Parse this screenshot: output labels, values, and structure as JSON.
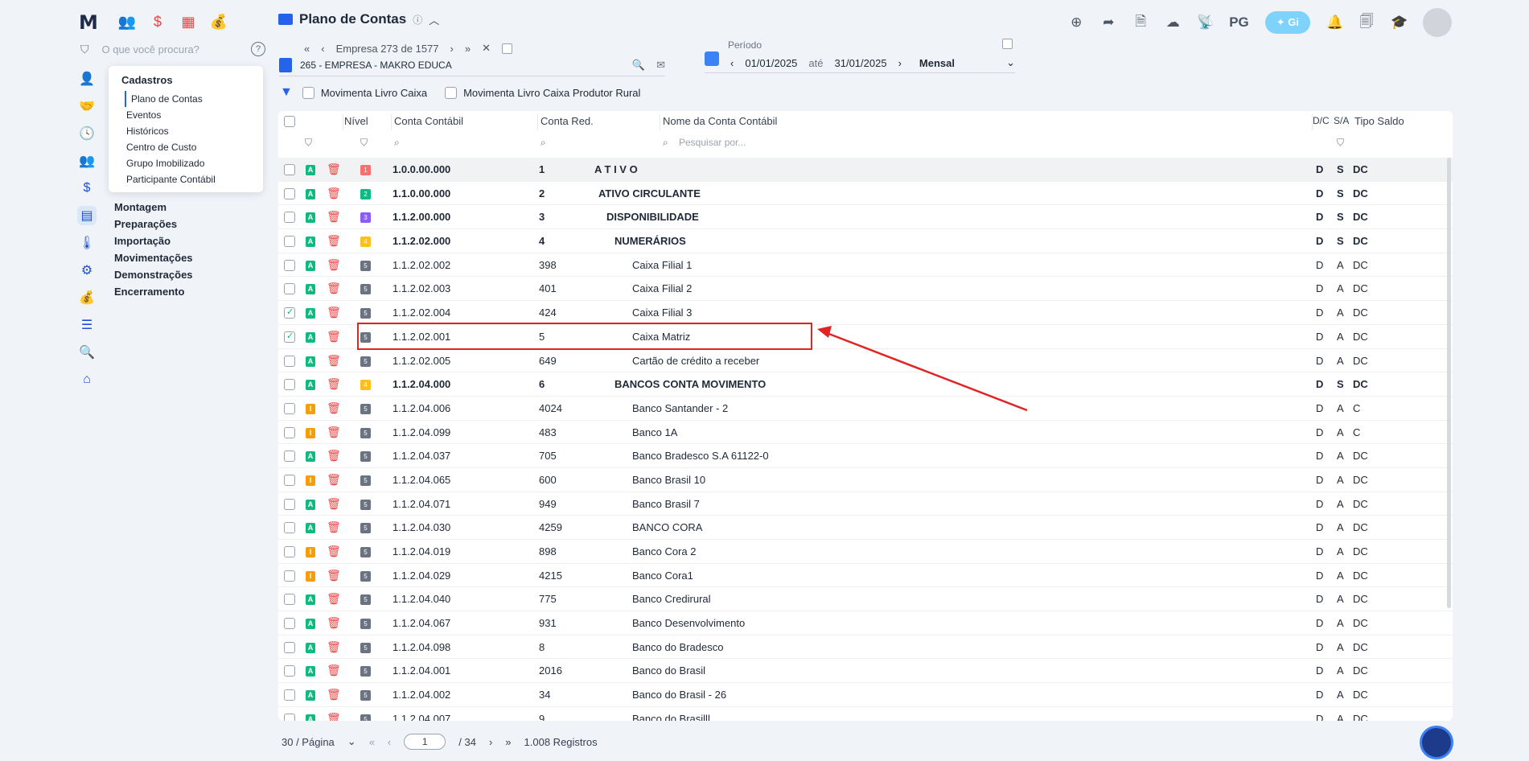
{
  "app": {
    "title": "Plano de Contas",
    "logo": "M"
  },
  "sidebar": {
    "search_placeholder": "O que você procura?",
    "popup": {
      "header": "Cadastros",
      "items": [
        "Plano de Contas",
        "Eventos",
        "Históricos",
        "Centro de Custo",
        "Grupo Imobilizado",
        "Participante Contábil"
      ]
    },
    "menu": [
      "Montagem",
      "Preparações",
      "Importação",
      "Movimentações",
      "Demonstrações",
      "Encerramento"
    ]
  },
  "header": {
    "pg_label": "PG",
    "gi_label": "Gi"
  },
  "empresa": {
    "nav_label": "Empresa 273 de 1577",
    "name": "265 - EMPRESA - MAKRO EDUCA"
  },
  "periodo": {
    "label": "Período",
    "start": "01/01/2025",
    "ate": "até",
    "end": "31/01/2025",
    "mode": "Mensal"
  },
  "filters": {
    "f1": "Movimenta Livro Caixa",
    "f2": "Movimenta Livro Caixa Produtor Rural"
  },
  "table": {
    "headers": {
      "nivel": "Nível",
      "conta": "Conta Contábil",
      "red": "Conta Red.",
      "nome": "Nome da Conta Contábil",
      "dc": "D/C",
      "sa": "S/A",
      "tipo": "Tipo Saldo"
    },
    "name_search_placeholder": "Pesquisar por...",
    "rows": [
      {
        "status": "A",
        "level": "1",
        "conta": "1.0.0.00.000",
        "red": "1",
        "nome": "A T I V O",
        "dc": "D",
        "sa": "S",
        "tipo": "DC",
        "bold": true,
        "checked": false
      },
      {
        "status": "A",
        "level": "2",
        "conta": "1.1.0.00.000",
        "red": "2",
        "nome": "ATIVO CIRCULANTE",
        "dc": "D",
        "sa": "S",
        "tipo": "DC",
        "bold": true,
        "checked": false
      },
      {
        "status": "A",
        "level": "3",
        "conta": "1.1.2.00.000",
        "red": "3",
        "nome": "DISPONIBILIDADE",
        "dc": "D",
        "sa": "S",
        "tipo": "DC",
        "bold": true,
        "checked": false
      },
      {
        "status": "A",
        "level": "4",
        "conta": "1.1.2.02.000",
        "red": "4",
        "nome": "NUMERÁRIOS",
        "dc": "D",
        "sa": "S",
        "tipo": "DC",
        "bold": true,
        "checked": false
      },
      {
        "status": "A",
        "level": "5",
        "conta": "1.1.2.02.002",
        "red": "398",
        "nome": "Caixa Filial 1",
        "dc": "D",
        "sa": "A",
        "tipo": "DC",
        "bold": false,
        "checked": false
      },
      {
        "status": "A",
        "level": "5",
        "conta": "1.1.2.02.003",
        "red": "401",
        "nome": "Caixa Filial 2",
        "dc": "D",
        "sa": "A",
        "tipo": "DC",
        "bold": false,
        "checked": false
      },
      {
        "status": "A",
        "level": "5",
        "conta": "1.1.2.02.004",
        "red": "424",
        "nome": "Caixa Filial 3",
        "dc": "D",
        "sa": "A",
        "tipo": "DC",
        "bold": false,
        "checked": true
      },
      {
        "status": "A",
        "level": "5",
        "conta": "1.1.2.02.001",
        "red": "5",
        "nome": "Caixa Matriz",
        "dc": "D",
        "sa": "A",
        "tipo": "DC",
        "bold": false,
        "checked": true
      },
      {
        "status": "A",
        "level": "5",
        "conta": "1.1.2.02.005",
        "red": "649",
        "nome": "Cartão de crédito a receber",
        "dc": "D",
        "sa": "A",
        "tipo": "DC",
        "bold": false,
        "checked": false
      },
      {
        "status": "A",
        "level": "4",
        "conta": "1.1.2.04.000",
        "red": "6",
        "nome": "BANCOS CONTA MOVIMENTO",
        "dc": "D",
        "sa": "S",
        "tipo": "DC",
        "bold": true,
        "checked": false
      },
      {
        "status": "I",
        "level": "5",
        "conta": "1.1.2.04.006",
        "red": "4024",
        "nome": "Banco Santander - 2",
        "dc": "D",
        "sa": "A",
        "tipo": "C",
        "bold": false,
        "checked": false
      },
      {
        "status": "I",
        "level": "5",
        "conta": "1.1.2.04.099",
        "red": "483",
        "nome": "Banco 1A",
        "dc": "D",
        "sa": "A",
        "tipo": "C",
        "bold": false,
        "checked": false
      },
      {
        "status": "A",
        "level": "5",
        "conta": "1.1.2.04.037",
        "red": "705",
        "nome": "Banco Bradesco S.A 61122-0",
        "dc": "D",
        "sa": "A",
        "tipo": "DC",
        "bold": false,
        "checked": false
      },
      {
        "status": "I",
        "level": "5",
        "conta": "1.1.2.04.065",
        "red": "600",
        "nome": "Banco Brasil 10",
        "dc": "D",
        "sa": "A",
        "tipo": "DC",
        "bold": false,
        "checked": false
      },
      {
        "status": "A",
        "level": "5",
        "conta": "1.1.2.04.071",
        "red": "949",
        "nome": "Banco Brasil 7",
        "dc": "D",
        "sa": "A",
        "tipo": "DC",
        "bold": false,
        "checked": false
      },
      {
        "status": "A",
        "level": "5",
        "conta": "1.1.2.04.030",
        "red": "4259",
        "nome": "BANCO CORA",
        "dc": "D",
        "sa": "A",
        "tipo": "DC",
        "bold": false,
        "checked": false
      },
      {
        "status": "I",
        "level": "5",
        "conta": "1.1.2.04.019",
        "red": "898",
        "nome": "Banco Cora 2",
        "dc": "D",
        "sa": "A",
        "tipo": "DC",
        "bold": false,
        "checked": false
      },
      {
        "status": "I",
        "level": "5",
        "conta": "1.1.2.04.029",
        "red": "4215",
        "nome": "Banco Cora1",
        "dc": "D",
        "sa": "A",
        "tipo": "DC",
        "bold": false,
        "checked": false
      },
      {
        "status": "A",
        "level": "5",
        "conta": "1.1.2.04.040",
        "red": "775",
        "nome": "Banco Credirural",
        "dc": "D",
        "sa": "A",
        "tipo": "DC",
        "bold": false,
        "checked": false
      },
      {
        "status": "A",
        "level": "5",
        "conta": "1.1.2.04.067",
        "red": "931",
        "nome": "Banco Desenvolvimento",
        "dc": "D",
        "sa": "A",
        "tipo": "DC",
        "bold": false,
        "checked": false
      },
      {
        "status": "A",
        "level": "5",
        "conta": "1.1.2.04.098",
        "red": "8",
        "nome": "Banco do Bradesco",
        "dc": "D",
        "sa": "A",
        "tipo": "DC",
        "bold": false,
        "checked": false
      },
      {
        "status": "A",
        "level": "5",
        "conta": "1.1.2.04.001",
        "red": "2016",
        "nome": "Banco do Brasil",
        "dc": "D",
        "sa": "A",
        "tipo": "DC",
        "bold": false,
        "checked": false
      },
      {
        "status": "A",
        "level": "5",
        "conta": "1.1.2.04.002",
        "red": "34",
        "nome": "Banco do Brasil - 26",
        "dc": "D",
        "sa": "A",
        "tipo": "DC",
        "bold": false,
        "checked": false
      },
      {
        "status": "A",
        "level": "5",
        "conta": "1.1.2.04.007",
        "red": "9",
        "nome": "Banco do Brasilll",
        "dc": "D",
        "sa": "A",
        "tipo": "DC",
        "bold": false,
        "checked": false
      }
    ]
  },
  "pager": {
    "per_page": "30 / Página",
    "page": "1",
    "total_pages": "/ 34",
    "records": "1.008 Registros"
  },
  "colors": {
    "status_A": "#10b981",
    "status_I": "#f59e0b",
    "level_1": "#f87171",
    "level_2": "#10b981",
    "level_3": "#8b5cf6",
    "level_4": "#fbbf24",
    "level_5": "#6b7280",
    "highlight": "#e02424"
  }
}
